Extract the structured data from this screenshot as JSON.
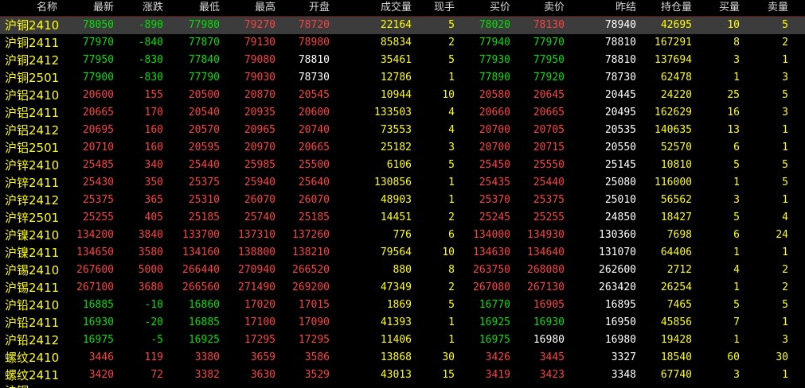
{
  "headers": [
    "名称",
    "最新",
    "涨跌",
    "最低",
    "最高",
    "开盘",
    "成交量",
    "现手",
    "买价",
    "卖价",
    "昨结",
    "持仓量",
    "买量",
    "卖量"
  ],
  "colors": {
    "up": "#ff4040",
    "down": "#00e000",
    "flat": "#ffffff",
    "yellow": "#ffff00"
  },
  "rows": [
    {
      "name": "沪铜2410",
      "last": "78050",
      "chg": "-890",
      "low": "77980",
      "high": "79270",
      "open": "78720",
      "vol": "22164",
      "hand": "5",
      "bid": "78020",
      "ask": "78130",
      "prev": "78940",
      "oi": "42695",
      "bidv": "10",
      "askv": "5",
      "cols": [
        "g",
        "g",
        "g",
        "r",
        "r",
        "y",
        "y",
        "g",
        "r",
        "w",
        "y",
        "y",
        "y"
      ],
      "selected": true
    },
    {
      "name": "沪铜2411",
      "last": "77970",
      "chg": "-840",
      "low": "77870",
      "high": "79130",
      "open": "78980",
      "vol": "85834",
      "hand": "2",
      "bid": "77940",
      "ask": "77970",
      "prev": "78810",
      "oi": "167291",
      "bidv": "8",
      "askv": "2",
      "cols": [
        "g",
        "g",
        "g",
        "r",
        "r",
        "y",
        "y",
        "g",
        "g",
        "w",
        "y",
        "y",
        "y"
      ]
    },
    {
      "name": "沪铜2412",
      "last": "77950",
      "chg": "-830",
      "low": "77840",
      "high": "79080",
      "open": "78810",
      "vol": "35461",
      "hand": "5",
      "bid": "77930",
      "ask": "77950",
      "prev": "78810",
      "oi": "137694",
      "bidv": "3",
      "askv": "1",
      "cols": [
        "g",
        "g",
        "g",
        "r",
        "w",
        "y",
        "y",
        "g",
        "g",
        "w",
        "y",
        "y",
        "y"
      ]
    },
    {
      "name": "沪铜2501",
      "last": "77900",
      "chg": "-830",
      "low": "77790",
      "high": "79030",
      "open": "78730",
      "vol": "12786",
      "hand": "1",
      "bid": "77890",
      "ask": "77920",
      "prev": "78730",
      "oi": "62478",
      "bidv": "1",
      "askv": "3",
      "cols": [
        "g",
        "g",
        "g",
        "r",
        "w",
        "y",
        "y",
        "g",
        "g",
        "w",
        "y",
        "y",
        "y"
      ]
    },
    {
      "name": "沪铝2410",
      "last": "20600",
      "chg": "155",
      "low": "20500",
      "high": "20870",
      "open": "20545",
      "vol": "10944",
      "hand": "10",
      "bid": "20580",
      "ask": "20645",
      "prev": "20445",
      "oi": "24220",
      "bidv": "25",
      "askv": "5",
      "cols": [
        "r",
        "r",
        "r",
        "r",
        "r",
        "y",
        "y",
        "r",
        "r",
        "w",
        "y",
        "y",
        "y"
      ]
    },
    {
      "name": "沪铝2411",
      "last": "20665",
      "chg": "170",
      "low": "20540",
      "high": "20935",
      "open": "20600",
      "vol": "133503",
      "hand": "4",
      "bid": "20660",
      "ask": "20665",
      "prev": "20495",
      "oi": "162629",
      "bidv": "16",
      "askv": "3",
      "cols": [
        "r",
        "r",
        "r",
        "r",
        "r",
        "y",
        "y",
        "r",
        "r",
        "w",
        "y",
        "y",
        "y"
      ]
    },
    {
      "name": "沪铝2412",
      "last": "20695",
      "chg": "160",
      "low": "20570",
      "high": "20965",
      "open": "20740",
      "vol": "73553",
      "hand": "4",
      "bid": "20700",
      "ask": "20705",
      "prev": "20535",
      "oi": "140635",
      "bidv": "13",
      "askv": "1",
      "cols": [
        "r",
        "r",
        "r",
        "r",
        "r",
        "y",
        "y",
        "r",
        "r",
        "w",
        "y",
        "y",
        "y"
      ]
    },
    {
      "name": "沪铝2501",
      "last": "20710",
      "chg": "160",
      "low": "20595",
      "high": "20970",
      "open": "20665",
      "vol": "25182",
      "hand": "3",
      "bid": "20700",
      "ask": "20715",
      "prev": "20550",
      "oi": "52570",
      "bidv": "6",
      "askv": "1",
      "cols": [
        "r",
        "r",
        "r",
        "r",
        "r",
        "y",
        "y",
        "r",
        "r",
        "w",
        "y",
        "y",
        "y"
      ]
    },
    {
      "name": "沪锌2410",
      "last": "25485",
      "chg": "340",
      "low": "25440",
      "high": "25985",
      "open": "25500",
      "vol": "6106",
      "hand": "5",
      "bid": "25450",
      "ask": "25550",
      "prev": "25145",
      "oi": "10810",
      "bidv": "5",
      "askv": "5",
      "cols": [
        "r",
        "r",
        "r",
        "r",
        "r",
        "y",
        "y",
        "r",
        "r",
        "w",
        "y",
        "y",
        "y"
      ]
    },
    {
      "name": "沪锌2411",
      "last": "25430",
      "chg": "350",
      "low": "25375",
      "high": "25940",
      "open": "25640",
      "vol": "130856",
      "hand": "1",
      "bid": "25435",
      "ask": "25440",
      "prev": "25080",
      "oi": "116000",
      "bidv": "1",
      "askv": "5",
      "cols": [
        "r",
        "r",
        "r",
        "r",
        "r",
        "y",
        "y",
        "r",
        "r",
        "w",
        "y",
        "y",
        "y"
      ]
    },
    {
      "name": "沪锌2412",
      "last": "25375",
      "chg": "365",
      "low": "25310",
      "high": "26070",
      "open": "26070",
      "vol": "48903",
      "hand": "1",
      "bid": "25370",
      "ask": "25375",
      "prev": "25010",
      "oi": "56562",
      "bidv": "3",
      "askv": "1",
      "cols": [
        "r",
        "r",
        "r",
        "r",
        "r",
        "y",
        "y",
        "r",
        "r",
        "w",
        "y",
        "y",
        "y"
      ]
    },
    {
      "name": "沪锌2501",
      "last": "25255",
      "chg": "405",
      "low": "25185",
      "high": "25740",
      "open": "25185",
      "vol": "14451",
      "hand": "2",
      "bid": "25245",
      "ask": "25255",
      "prev": "24850",
      "oi": "18427",
      "bidv": "5",
      "askv": "4",
      "cols": [
        "r",
        "r",
        "r",
        "r",
        "r",
        "y",
        "y",
        "r",
        "r",
        "w",
        "y",
        "y",
        "y"
      ]
    },
    {
      "name": "沪镍2410",
      "last": "134200",
      "chg": "3840",
      "low": "133700",
      "high": "137310",
      "open": "137260",
      "vol": "776",
      "hand": "6",
      "bid": "134000",
      "ask": "134930",
      "prev": "130360",
      "oi": "7698",
      "bidv": "6",
      "askv": "24",
      "cols": [
        "r",
        "r",
        "r",
        "r",
        "r",
        "y",
        "y",
        "r",
        "r",
        "w",
        "y",
        "y",
        "y"
      ]
    },
    {
      "name": "沪镍2411",
      "last": "134650",
      "chg": "3580",
      "low": "134160",
      "high": "138800",
      "open": "138210",
      "vol": "79564",
      "hand": "10",
      "bid": "134630",
      "ask": "134640",
      "prev": "131070",
      "oi": "64406",
      "bidv": "1",
      "askv": "1",
      "cols": [
        "r",
        "r",
        "r",
        "r",
        "r",
        "y",
        "y",
        "r",
        "r",
        "w",
        "y",
        "y",
        "y"
      ]
    },
    {
      "name": "沪锡2410",
      "last": "267600",
      "chg": "5000",
      "low": "266440",
      "high": "270940",
      "open": "266520",
      "vol": "880",
      "hand": "8",
      "bid": "263750",
      "ask": "268080",
      "prev": "262600",
      "oi": "2712",
      "bidv": "4",
      "askv": "2",
      "cols": [
        "r",
        "r",
        "r",
        "r",
        "r",
        "y",
        "y",
        "r",
        "r",
        "w",
        "y",
        "y",
        "y"
      ]
    },
    {
      "name": "沪锡2411",
      "last": "267100",
      "chg": "3680",
      "low": "266560",
      "high": "271490",
      "open": "269200",
      "vol": "47349",
      "hand": "2",
      "bid": "267080",
      "ask": "267130",
      "prev": "263420",
      "oi": "26254",
      "bidv": "1",
      "askv": "2",
      "cols": [
        "r",
        "r",
        "r",
        "r",
        "r",
        "y",
        "y",
        "r",
        "r",
        "w",
        "y",
        "y",
        "y"
      ]
    },
    {
      "name": "沪铅2410",
      "last": "16885",
      "chg": "-10",
      "low": "16860",
      "high": "17020",
      "open": "17015",
      "vol": "1869",
      "hand": "5",
      "bid": "16770",
      "ask": "16905",
      "prev": "16895",
      "oi": "7465",
      "bidv": "5",
      "askv": "5",
      "cols": [
        "g",
        "g",
        "g",
        "r",
        "r",
        "y",
        "y",
        "g",
        "r",
        "w",
        "y",
        "y",
        "y"
      ]
    },
    {
      "name": "沪铅2411",
      "last": "16930",
      "chg": "-20",
      "low": "16885",
      "high": "17100",
      "open": "17090",
      "vol": "41393",
      "hand": "1",
      "bid": "16925",
      "ask": "16930",
      "prev": "16950",
      "oi": "45856",
      "bidv": "7",
      "askv": "1",
      "cols": [
        "g",
        "g",
        "g",
        "r",
        "r",
        "y",
        "y",
        "g",
        "g",
        "w",
        "y",
        "y",
        "y"
      ]
    },
    {
      "name": "沪铅2412",
      "last": "16975",
      "chg": "-5",
      "low": "16925",
      "high": "17295",
      "open": "17295",
      "vol": "11406",
      "hand": "1",
      "bid": "16975",
      "ask": "16980",
      "prev": "16980",
      "oi": "19428",
      "bidv": "1",
      "askv": "3",
      "cols": [
        "g",
        "g",
        "g",
        "r",
        "r",
        "y",
        "y",
        "g",
        "w",
        "w",
        "y",
        "y",
        "y"
      ]
    },
    {
      "name": "螺纹2410",
      "last": "3446",
      "chg": "119",
      "low": "3380",
      "high": "3659",
      "open": "3586",
      "vol": "13868",
      "hand": "30",
      "bid": "3426",
      "ask": "3445",
      "prev": "3327",
      "oi": "18540",
      "bidv": "60",
      "askv": "30",
      "cols": [
        "r",
        "r",
        "r",
        "r",
        "r",
        "y",
        "y",
        "r",
        "r",
        "w",
        "y",
        "y",
        "y"
      ]
    },
    {
      "name": "螺纹2411",
      "last": "3420",
      "chg": "72",
      "low": "3382",
      "high": "3630",
      "open": "3529",
      "vol": "43013",
      "hand": "15",
      "bid": "3419",
      "ask": "3423",
      "prev": "3348",
      "oi": "67740",
      "bidv": "3",
      "askv": "1",
      "cols": [
        "r",
        "r",
        "r",
        "r",
        "r",
        "y",
        "y",
        "r",
        "r",
        "w",
        "y",
        "y",
        "y"
      ]
    }
  ]
}
